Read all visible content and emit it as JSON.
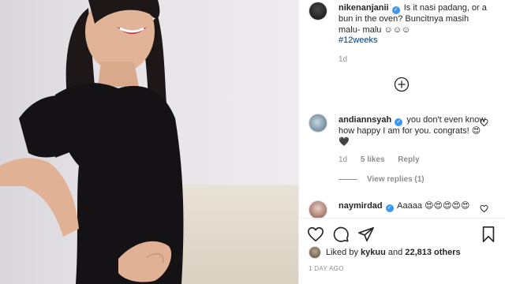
{
  "post": {
    "caption_user": "nikenanjanii",
    "caption_text": "Is it nasi padang, or a bun in the oven? Buncitnya masih malu- malu ☺☺☺",
    "hashtag": "#12weeks",
    "time": "1d"
  },
  "comments": [
    {
      "user": "andiannsyah",
      "text": "you don't even know how happy I am for you. congrats! 😍🖤",
      "time": "1d",
      "likes": "5 likes",
      "reply_label": "Reply",
      "view_replies": "View replies (1)"
    },
    {
      "user": "naymirdad",
      "text": "Aaaaa 😍😍😍😍😍"
    }
  ],
  "likes": {
    "prefix": "Liked by",
    "user": "kykuu",
    "joiner": "and",
    "others": "22,813 others"
  },
  "timestamp": "1 DAY AGO",
  "icons": {
    "like": "heart-icon",
    "comment": "comment-icon",
    "share": "share-icon",
    "save": "bookmark-icon",
    "load_more": "plus-circle-icon",
    "verified": "verified-badge-icon"
  },
  "colors": {
    "verified": "#3897f0",
    "hashtag": "#00376b",
    "muted": "#8e8e8e",
    "text": "#262626"
  }
}
